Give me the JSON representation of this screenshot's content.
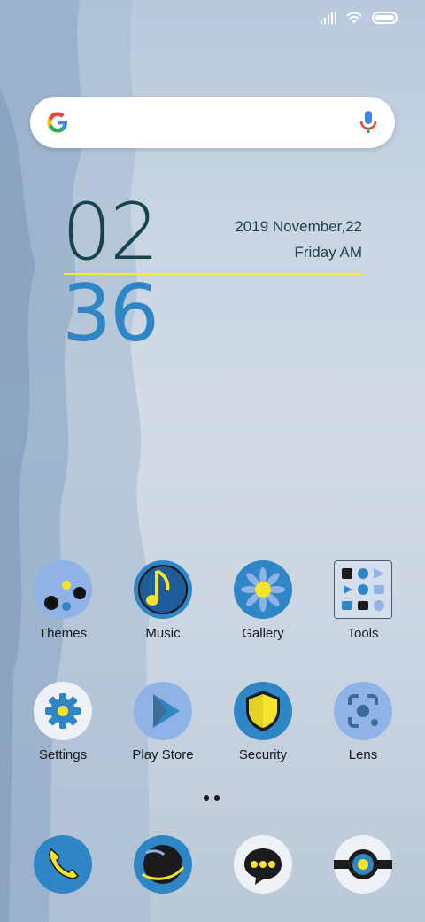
{
  "status_bar": {
    "signal_icon": "signal-icon",
    "wifi_icon": "wifi-icon",
    "battery_icon": "battery-icon"
  },
  "search": {
    "logo_icon": "google-logo-icon",
    "mic_icon": "mic-icon"
  },
  "clock": {
    "hour": "02",
    "minute": "36",
    "date": "2019  November,22",
    "day_period": "Friday  AM"
  },
  "apps_row1": [
    {
      "label": "Themes"
    },
    {
      "label": "Music"
    },
    {
      "label": "Gallery"
    },
    {
      "label": "Tools"
    }
  ],
  "apps_row2": [
    {
      "label": "Settings"
    },
    {
      "label": "Play Store"
    },
    {
      "label": "Security"
    },
    {
      "label": "Lens"
    }
  ],
  "dock": [
    {
      "icon": "phone-icon"
    },
    {
      "icon": "browser-icon"
    },
    {
      "icon": "messages-icon"
    },
    {
      "icon": "camera-icon"
    }
  ],
  "colors": {
    "accent_blue": "#2f86c6",
    "accent_yellow": "#f5e93a",
    "icon_light": "#8fb3e6"
  }
}
